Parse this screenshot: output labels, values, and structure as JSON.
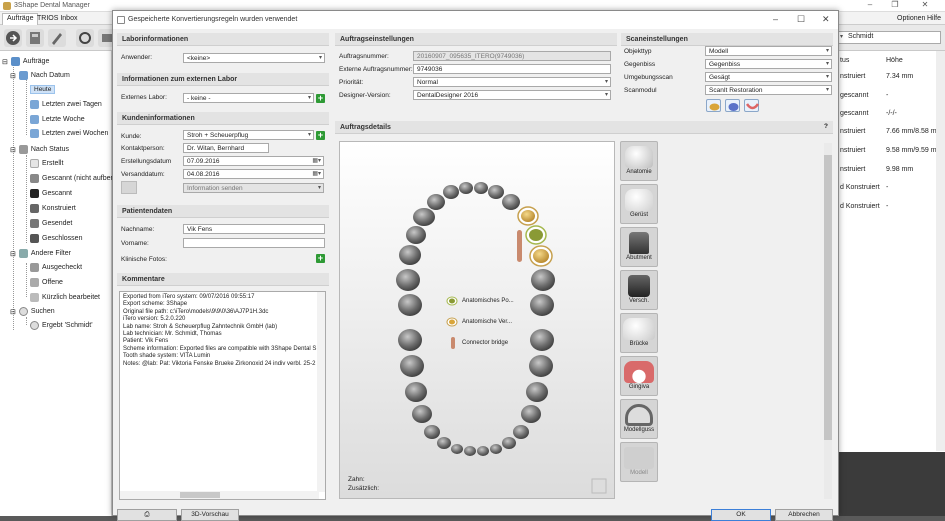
{
  "app": {
    "title": "3Shape Dental Manager",
    "tabs": [
      "Aufträge",
      "TRIOS Inbox"
    ],
    "menu_right": [
      "Optionen",
      "Hilfe"
    ],
    "search_value": "Schmidt"
  },
  "sidebar": {
    "root": "Aufträge",
    "groups": [
      {
        "label": "Nach Datum",
        "items": [
          "Heute",
          "Letzten zwei Tagen",
          "Letzte Woche",
          "Letzten zwei Wochen"
        ]
      },
      {
        "label": "Nach Status",
        "items": [
          "Erstellt",
          "Gescannt (nicht aufbereitet)",
          "Gescannt",
          "Konstruiert",
          "Gesendet",
          "Geschlossen"
        ]
      },
      {
        "label": "Andere Filter",
        "items": [
          "Ausgecheckt",
          "Offene",
          "Kürzlich bearbeitet"
        ]
      },
      {
        "label": "Suchen",
        "items": [
          "Ergebt 'Schmidt'"
        ]
      }
    ],
    "selected": "Heute"
  },
  "right_panel": {
    "header": [
      "tus",
      "Höhe"
    ],
    "rows": [
      [
        "nstruiert",
        "7.34 mm"
      ],
      [
        "gescannt",
        "-"
      ],
      [
        "gescannt",
        "-/-/-"
      ],
      [
        "nstruiert",
        "7.66 mm/8.58 mm"
      ],
      [
        "nstruiert",
        "9.58 mm/9.59 mm"
      ],
      [
        "nstruiert",
        "9.98 mm"
      ],
      [
        "d Konstruiert",
        "-"
      ],
      [
        "d Konstruiert",
        "-"
      ]
    ]
  },
  "dialog": {
    "title": "Gespeicherte Konvertierungsregeln wurden verwendet",
    "labor": {
      "header": "Laborinformationen",
      "anwender_label": "Anwender:",
      "anwender_value": "<keine>"
    },
    "extern": {
      "header": "Informationen zum externen Labor",
      "label": "Externes Labor:",
      "value": "- keine -"
    },
    "kunde": {
      "header": "Kundeninformationen",
      "kunde_label": "Kunde:",
      "kunde_value": "Stroh + Scheuerpflug",
      "kontakt_label": "Kontaktperson:",
      "kontakt_value": "Dr. Witan, Bernhard",
      "erstellung_label": "Erstellungsdatum",
      "erstellung_value": "07.09.2016",
      "versand_label": "Versanddatum:",
      "versand_value": "04.08.2016",
      "info_senden": "Information senden"
    },
    "patient": {
      "header": "Patientendaten",
      "nachname_label": "Nachname:",
      "nachname_value": "Vik Fens",
      "vorname_label": "Vorname:",
      "vorname_value": "",
      "fotos_label": "Klinische Fotos:"
    },
    "kommentare": {
      "header": "Kommentare",
      "lines": [
        "Exported from iTero system: 09/07/2016 09:55:17",
        "Export scheme: 3Shape",
        "Original file path: c:\\iTero\\models\\9\\9\\0\\36\\AJ7P1H.3dc",
        "iTero version: 5.2.0.220",
        "Lab name: Stroh & Scheuerpflug Zahntechnik GmbH (lab)",
        "Lab technician: Mr. Schmidt, Thomas",
        "Patient: Vik Fens",
        "Scheme information: Exported files are compatible with 3Shape Dental S",
        "Tooth shade system: VITA Lumin",
        "Notes: @lab: Pat: Viktoria Fenske Brueke Zirkonoxid 24 indiv verbl. 25-2"
      ]
    },
    "auftrag": {
      "header": "Auftragseinstellungen",
      "nummer_label": "Auftragsnummer:",
      "nummer_value": "20160907_095635_ITERO(9749036)",
      "extern_label": "Externe Auftragsnummer:",
      "extern_value": "9749036",
      "prio_label": "Priorität:",
      "prio_value": "Normal",
      "designer_label": "Designer-Version:",
      "designer_value": "DentalDesigner 2016"
    },
    "scan": {
      "header": "Scaneinstellungen",
      "objekttyp_label": "Objekttyp",
      "objekttyp_value": "Modell",
      "gegenbiss_label": "Gegenbiss",
      "gegenbiss_value": "Gegenbiss",
      "umgebung_label": "Umgebungsscan",
      "umgebung_value": "Gesägt",
      "scanmodul_label": "Scanmodul",
      "scanmodul_value": "ScanIt Restoration"
    },
    "details": {
      "header": "Auftragsdetails",
      "help": "?",
      "legend": [
        "Anatomisches Po...",
        "Anatomische Ver...",
        "Connector bridge"
      ],
      "zahn_label": "Zahn:",
      "zusatz_label": "Zusätzlich:"
    },
    "tools": [
      "Anatomie",
      "Gerüst",
      "Abutment",
      "Versch.",
      "Brücke",
      "Gingiva",
      "Modellguss",
      "Modell"
    ],
    "buttons": {
      "ok": "OK",
      "cancel": "Abbrechen",
      "preview": "3D-Vorschau"
    }
  },
  "colors": {
    "accent_green": "#2e9a35",
    "selection": "#cfe2f7",
    "gold": "#c9a24a"
  }
}
